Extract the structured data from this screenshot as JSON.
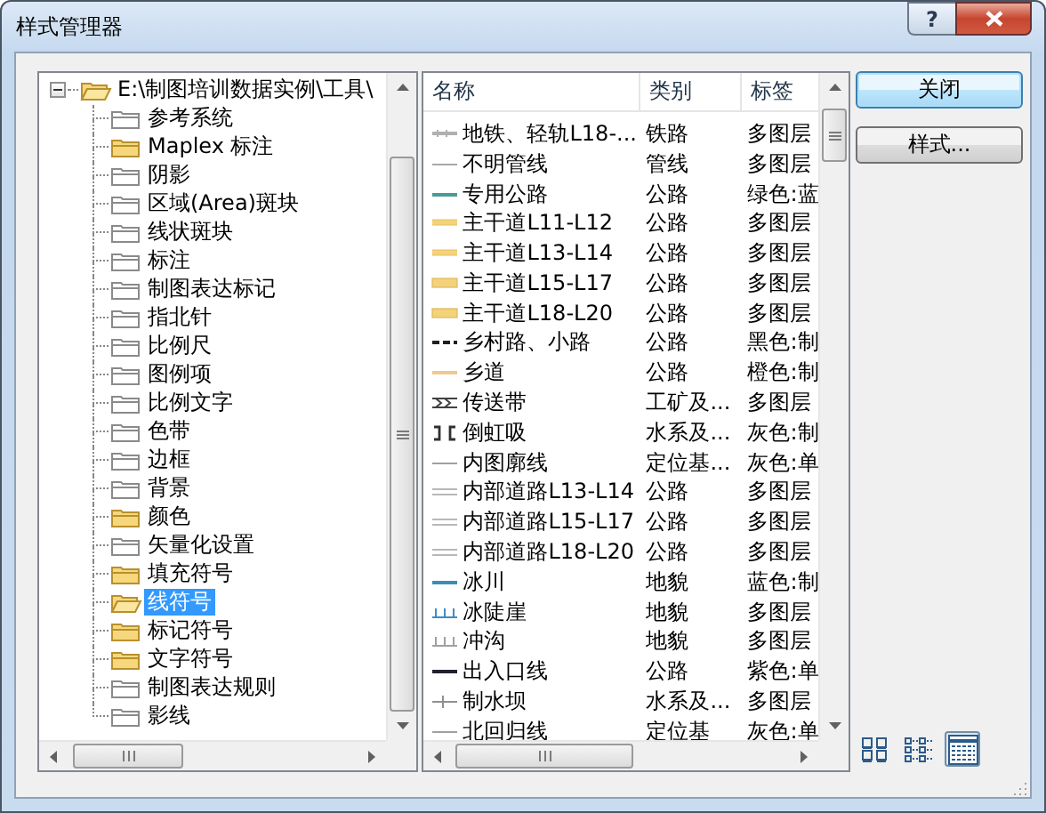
{
  "window": {
    "title": "样式管理器",
    "help_button": "?"
  },
  "tree": {
    "root": {
      "label": "E:\\制图培训数据实例\\工具\\",
      "expanded": true,
      "selected": false,
      "children": [
        {
          "label": "参考系统",
          "filled": false,
          "selected": false
        },
        {
          "label": "Maplex 标注",
          "filled": true,
          "selected": false
        },
        {
          "label": "阴影",
          "filled": false,
          "selected": false
        },
        {
          "label": "区域(Area)斑块",
          "filled": false,
          "selected": false
        },
        {
          "label": "线状斑块",
          "filled": false,
          "selected": false
        },
        {
          "label": "标注",
          "filled": false,
          "selected": false
        },
        {
          "label": "制图表达标记",
          "filled": false,
          "selected": false
        },
        {
          "label": "指北针",
          "filled": false,
          "selected": false
        },
        {
          "label": "比例尺",
          "filled": false,
          "selected": false
        },
        {
          "label": "图例项",
          "filled": false,
          "selected": false
        },
        {
          "label": "比例文字",
          "filled": false,
          "selected": false
        },
        {
          "label": "色带",
          "filled": false,
          "selected": false
        },
        {
          "label": "边框",
          "filled": false,
          "selected": false
        },
        {
          "label": "背景",
          "filled": false,
          "selected": false
        },
        {
          "label": "颜色",
          "filled": true,
          "selected": false
        },
        {
          "label": "矢量化设置",
          "filled": false,
          "selected": false
        },
        {
          "label": "填充符号",
          "filled": true,
          "selected": false
        },
        {
          "label": "线符号",
          "filled": true,
          "selected": true
        },
        {
          "label": "标记符号",
          "filled": true,
          "selected": false
        },
        {
          "label": "文字符号",
          "filled": true,
          "selected": false
        },
        {
          "label": "制图表达规则",
          "filled": false,
          "selected": false
        },
        {
          "label": "影线",
          "filled": false,
          "selected": false
        }
      ]
    }
  },
  "list": {
    "columns": [
      "名称",
      "类别",
      "标签"
    ],
    "rows": [
      {
        "name": "地铁、轻轨L18-...",
        "category": "铁路",
        "tag": "多图层",
        "kind": "rail",
        "color": "#b0b0b0"
      },
      {
        "name": "不明管线",
        "category": "管线",
        "tag": "多图层",
        "kind": "thin",
        "color": "#a8a8a8"
      },
      {
        "name": "专用公路",
        "category": "公路",
        "tag": "绿色:蓝",
        "kind": "line",
        "color": "#4a9a9a"
      },
      {
        "name": "主干道L11-L12",
        "category": "公路",
        "tag": "多图层",
        "kind": "road",
        "color": "#f3d27a"
      },
      {
        "name": "主干道L13-L14",
        "category": "公路",
        "tag": "多图层",
        "kind": "road",
        "color": "#f3d27a"
      },
      {
        "name": "主干道L15-L17",
        "category": "公路",
        "tag": "多图层",
        "kind": "wide",
        "color": "#f3d27a"
      },
      {
        "name": "主干道L18-L20",
        "category": "公路",
        "tag": "多图层",
        "kind": "wide",
        "color": "#f3d27a"
      },
      {
        "name": "乡村路、小路",
        "category": "公路",
        "tag": "黑色:制",
        "kind": "dashed",
        "color": "#202020"
      },
      {
        "name": "乡道",
        "category": "公路",
        "tag": "橙色:制",
        "kind": "line",
        "color": "#f0c890"
      },
      {
        "name": "传送带",
        "category": "工矿及...",
        "tag": "多图层",
        "kind": "conveyor",
        "color": "#404040"
      },
      {
        "name": "倒虹吸",
        "category": "水系及...",
        "tag": "灰色:制",
        "kind": "siphon",
        "color": "#303030"
      },
      {
        "name": "内图廓线",
        "category": "定位基...",
        "tag": "灰色:单",
        "kind": "thin",
        "color": "#a0a0a0"
      },
      {
        "name": "内部道路L13-L14",
        "category": "公路",
        "tag": "多图层",
        "kind": "double",
        "color": "#b8b8b8"
      },
      {
        "name": "内部道路L15-L17",
        "category": "公路",
        "tag": "多图层",
        "kind": "double",
        "color": "#b8b8b8"
      },
      {
        "name": "内部道路L18-L20",
        "category": "公路",
        "tag": "多图层",
        "kind": "double",
        "color": "#b8b8b8"
      },
      {
        "name": "冰川",
        "category": "地貌",
        "tag": "蓝色:制",
        "kind": "line",
        "color": "#3c8cb4"
      },
      {
        "name": "冰陡崖",
        "category": "地貌",
        "tag": "多图层",
        "kind": "ticks",
        "color": "#3c8cc8"
      },
      {
        "name": "冲沟",
        "category": "地貌",
        "tag": "多图层",
        "kind": "ticks",
        "color": "#a0a0a0"
      },
      {
        "name": "出入口线",
        "category": "公路",
        "tag": "紫色:单",
        "kind": "line",
        "color": "#202030"
      },
      {
        "name": "制水坝",
        "category": "水系及...",
        "tag": "多图层",
        "kind": "cross",
        "color": "#909090"
      },
      {
        "name": "北回归线",
        "category": "定位基",
        "tag": "灰色:单",
        "kind": "thin",
        "color": "#a0a0a0"
      }
    ]
  },
  "buttons": [
    {
      "label": "关闭",
      "focused": true
    },
    {
      "label": "样式..."
    }
  ],
  "views": [
    {
      "kind": "large-icons",
      "selected": false
    },
    {
      "kind": "small-icons",
      "selected": false
    },
    {
      "kind": "details",
      "selected": true
    }
  ]
}
